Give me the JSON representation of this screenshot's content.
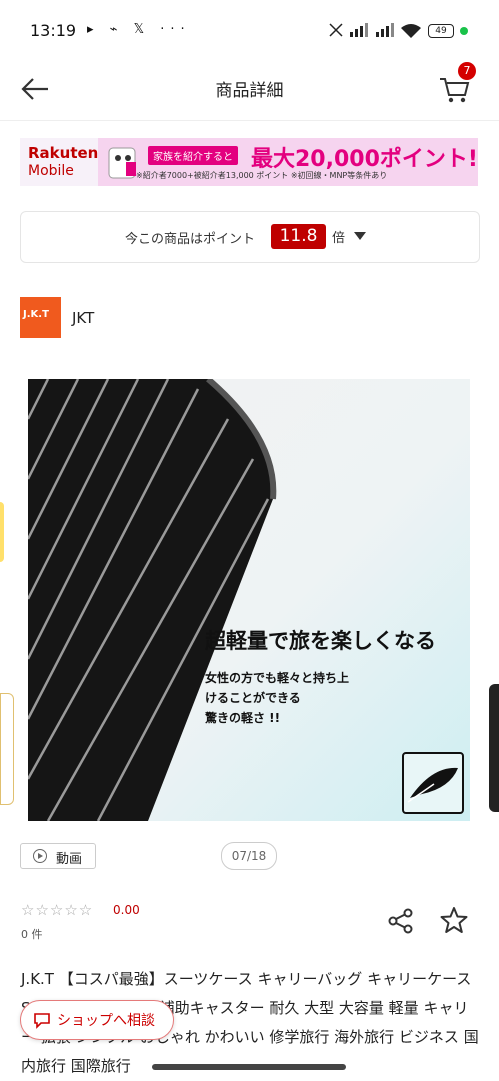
{
  "status_bar": {
    "time": "13:19",
    "left_icons": "▸ ⌁ 𝕏 ···",
    "battery": "49"
  },
  "header": {
    "title": "商品詳細",
    "cart_count": "7"
  },
  "banner": {
    "brand_line1": "Rakuten",
    "brand_line2": "Mobile",
    "tag": "家族を紹介すると",
    "headline": "最大20,000ポイント!",
    "fineprint": "※紹介者7000+被紹介者13,000 ポイント ※初回線・MNP等条件あり"
  },
  "points": {
    "prefix": "今この商品はポイント",
    "value": "11.8",
    "suffix": "倍"
  },
  "shop": {
    "logo_text": "J.K.T",
    "name": "JKT"
  },
  "product_image": {
    "headline": "超軽量で旅を楽しくなる",
    "subtext_line1": "女性の方でも軽々と持ち上",
    "subtext_line2": "けることができる",
    "subtext_line3": "驚きの軽さ !!"
  },
  "media": {
    "video_label": "動画",
    "counter": "07/18"
  },
  "rating": {
    "stars": "☆☆☆☆☆",
    "score": "0.00",
    "reviews": "0 件"
  },
  "description": {
    "text": "J.K.T 【コスパ最強】スーツケース キャリーバッグ キャリーケース Sサイズ ストッパー 補助キャスター 耐久 大型 大容量 軽量 キャリー 拡張 シンプル おしゃれ かわいい 修学旅行 海外旅行 ビジネス 国内旅行 国際旅行"
  },
  "chat_button": {
    "label": "ショップへ相談"
  },
  "colors": {
    "accent": "#bf0000",
    "shop_logo": "#f05a1e",
    "banner_pink": "#e3007f"
  }
}
